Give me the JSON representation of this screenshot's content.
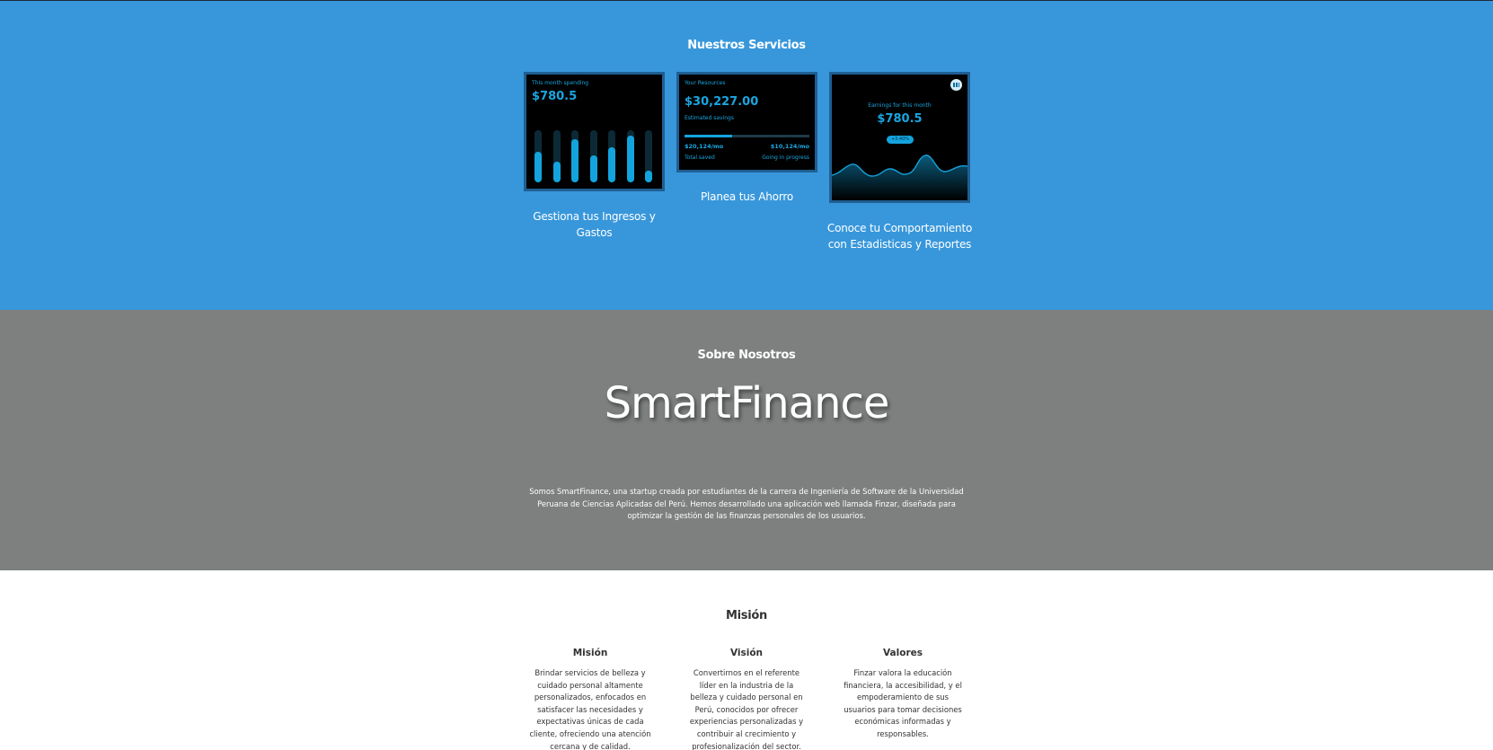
{
  "services": {
    "title": "Nuestros Servicios",
    "cards": [
      {
        "caption": "Gestiona tus Ingresos y Gastos",
        "label": "This month spending",
        "amount": "$780.5",
        "bars": [
          0.58,
          0.4,
          0.82,
          0.52,
          0.68,
          0.9,
          0.22
        ]
      },
      {
        "caption": "Planea tus Ahorro",
        "label": "Your Resources",
        "amount": "$30,227.00",
        "sublabel": "Estimated savings",
        "progress": 0.38,
        "left_value": "$20,124/mo",
        "left_label": "Total saved",
        "right_value": "$10,124/mo",
        "right_label": "Going in progress"
      },
      {
        "caption": "Conoce tu Comportamiento con Estadisticas y Reportes",
        "label": "Earnings for this month",
        "amount": "$780.5",
        "badge": "+3.40%",
        "icon": "trend-chart-icon"
      }
    ]
  },
  "about": {
    "title": "Sobre Nosotros",
    "brand": "SmartFinance",
    "text": "Somos SmartFinance, una startup creada por estudiantes de la carrera de Ingeniería de Software de la Universidad Peruana de Ciencias Aplicadas del Perú. Hemos desarrollado una aplicación web llamada Finzar, diseñada para optimizar la gestión de las finanzas personales de los usuarios."
  },
  "mission": {
    "title": "Misión",
    "columns": [
      {
        "heading": "Misión",
        "text": "Brindar servicios de belleza y cuidado personal altamente personalizados, enfocados en satisfacer las necesidades y expectativas únicas de cada cliente, ofreciendo una atención cercana y de calidad."
      },
      {
        "heading": "Visión",
        "text": "Convertirnos en el referente líder en la industria de la belleza y cuidado personal en Perú, conocidos por ofrecer experiencias personalizadas y contribuir al crecimiento y profesionalización del sector."
      },
      {
        "heading": "Valores",
        "text": "Finzar valora la educación financiera, la accesibilidad, y el empoderamiento de sus usuarios para tomar decisiones económicas informadas y responsables."
      }
    ]
  },
  "colors": {
    "services_bg": "#3897db",
    "about_bg": "#7d807f",
    "accent": "#13a4de",
    "card_bg": "#000000"
  }
}
